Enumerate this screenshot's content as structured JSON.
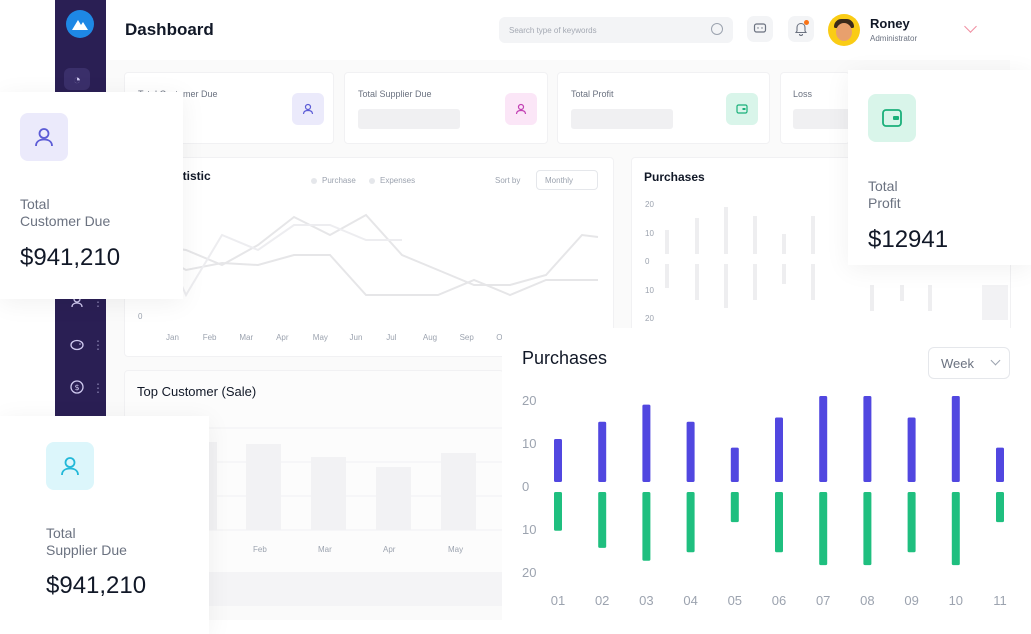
{
  "header": {
    "title": "Dashboard",
    "search_placeholder": "Search type of keywords",
    "user_name": "Roney",
    "user_role": "Administrator"
  },
  "summary_cards": [
    {
      "label": "Total Customer Due"
    },
    {
      "label": "Total Supplier Due"
    },
    {
      "label": "Total Profit"
    },
    {
      "label": "Loss"
    }
  ],
  "statistic": {
    "title_partial": "atistic",
    "legend": [
      "Purchase",
      "Expenses"
    ],
    "sort_label": "Sort by",
    "sort_value": "Monthly",
    "y_zero": "0",
    "months": [
      "Jan",
      "Feb",
      "Mar",
      "Apr",
      "May",
      "Jun",
      "Jul",
      "Aug",
      "Sep",
      "O"
    ]
  },
  "bg_purchases": {
    "title": "Purchases",
    "y_ticks": [
      "20",
      "10",
      "0",
      "10",
      "20"
    ]
  },
  "top_customer": {
    "title": "Top Customer (Sale)",
    "months": [
      "Feb",
      "Mar",
      "Apr",
      "May"
    ]
  },
  "overlay_cards": {
    "customer_due": {
      "label": "Total\nCustomer Due",
      "value": "$941,210",
      "icon": "user-icon",
      "color": "#5b5bd6",
      "bg": "#ebeafb"
    },
    "supplier_due": {
      "label": "Total\nSupplier Due",
      "value": "$941,210",
      "icon": "user-icon",
      "color": "#22b8d8",
      "bg": "#dcf6fb"
    },
    "profit": {
      "label": "Total\nProfit",
      "value": "$12941",
      "icon": "wallet-icon",
      "color": "#1ab07a",
      "bg": "#d9f5ea"
    }
  },
  "purchases_chart": {
    "title": "Purchases",
    "period": "Week"
  },
  "chart_data": {
    "type": "bar",
    "title": "Purchases",
    "categories": [
      "01",
      "02",
      "03",
      "04",
      "05",
      "06",
      "07",
      "08",
      "09",
      "10",
      "11"
    ],
    "y_ticks": [
      "20",
      "10",
      "0",
      "10",
      "20"
    ],
    "ylim": [
      -20,
      20
    ],
    "series": [
      {
        "values": [
          10,
          14,
          18,
          14,
          8,
          15,
          20,
          20,
          15,
          20,
          8
        ],
        "color": "#5147e0"
      },
      {
        "values": [
          -9,
          -13,
          -16,
          -14,
          -7,
          -14,
          -17,
          -17,
          -14,
          -17,
          -7
        ],
        "color": "#1fbf7f"
      }
    ]
  }
}
